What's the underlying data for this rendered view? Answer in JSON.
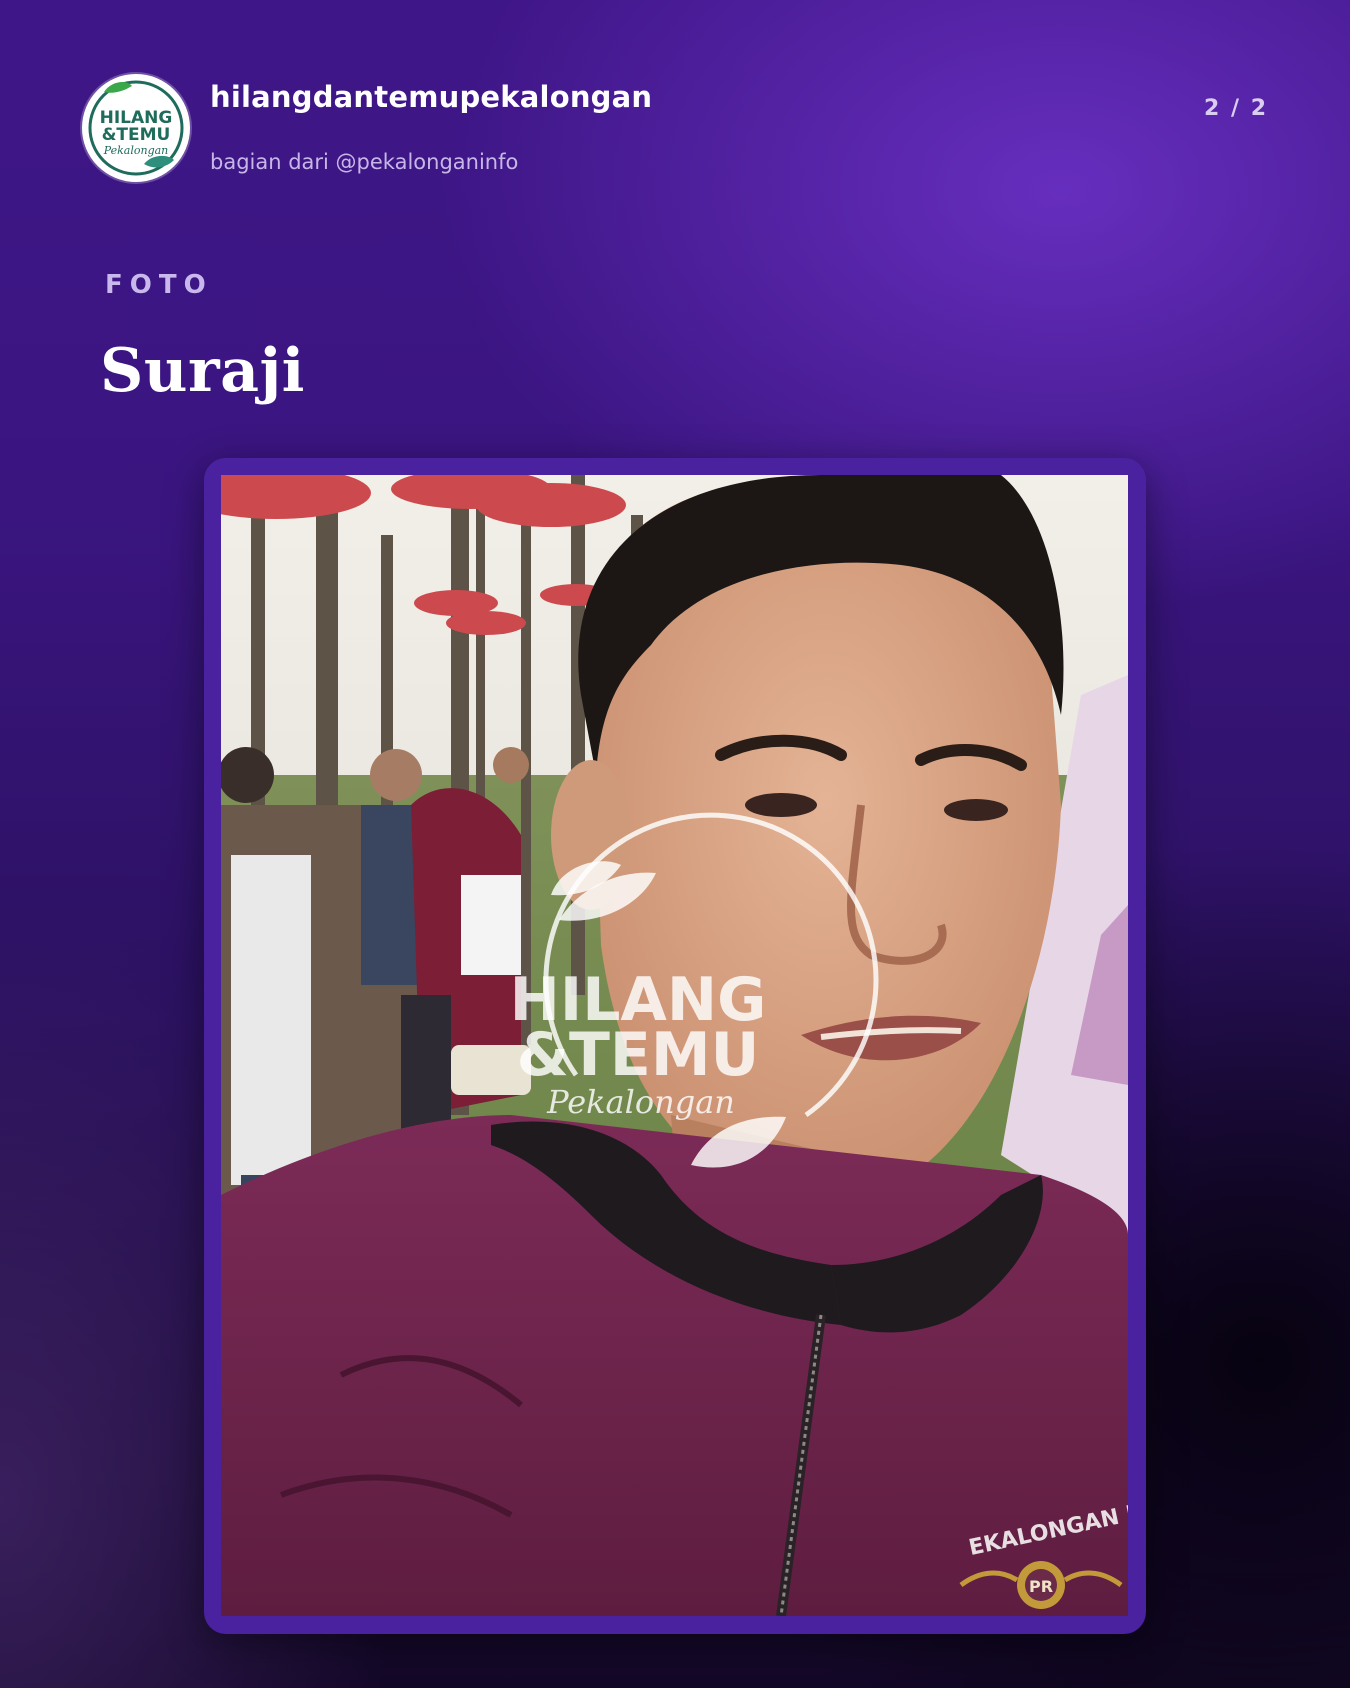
{
  "header": {
    "account_name": "hilangdantemupekalongan",
    "account_subtitle": "bagian dari @pekalonganinfo",
    "page_indicator": "2 / 2",
    "logo_alt": "logo",
    "logo_text_line1": "HILANG",
    "logo_text_line2": "&TEMU",
    "logo_text_script": "Pekalongan"
  },
  "post": {
    "section_label": "FOTO",
    "title": "Suraji"
  },
  "photo": {
    "watermark_line1": "HILANG",
    "watermark_line2": "&TEMU",
    "watermark_script": "Pekalongan",
    "badge_text": "EKALONGAN RANTAU",
    "badge_initials": "PR"
  },
  "colors": {
    "background_top": "#3f1688",
    "background_bottom": "#140828",
    "frame": "#4a22a0",
    "logo_green": "#1f6b5c",
    "leaf_green": "#3aa84a"
  }
}
